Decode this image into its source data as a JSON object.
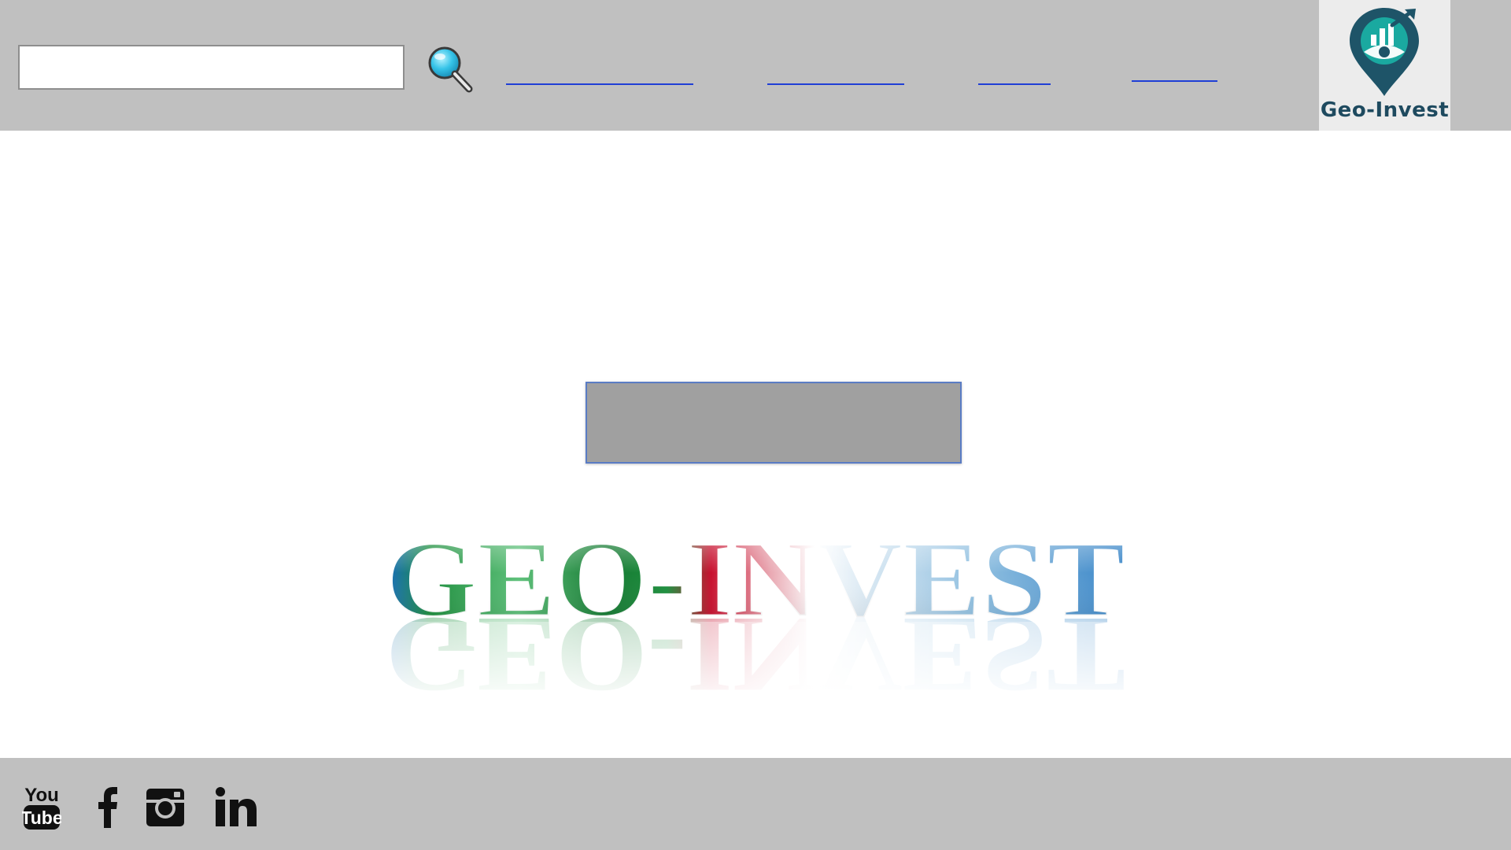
{
  "search": {
    "placeholder": ""
  },
  "nav": [
    {
      "label": ""
    },
    {
      "label": ""
    },
    {
      "label": ""
    },
    {
      "label": ""
    }
  ],
  "brand": {
    "name": "Geo-Invest",
    "icon": "map-pin-chart-icon",
    "color": "#1e4a5f",
    "accent": "#1aa9a0"
  },
  "main": {
    "cta_label": ""
  },
  "hero": {
    "logo_text": "GEO-INVEST",
    "colors": [
      "#1e8f3e",
      "#c8102e",
      "#3a86c8"
    ]
  },
  "footer": {
    "social": [
      {
        "name": "youtube",
        "icon": "youtube-icon"
      },
      {
        "name": "facebook",
        "icon": "facebook-icon"
      },
      {
        "name": "instagram",
        "icon": "instagram-icon"
      },
      {
        "name": "linkedin",
        "icon": "linkedin-icon"
      }
    ]
  },
  "colors": {
    "header_bg": "#c0c0c0",
    "footer_bg": "#c0c0c0",
    "link": "#1f3fd6",
    "button_bg": "#a0a0a0"
  }
}
